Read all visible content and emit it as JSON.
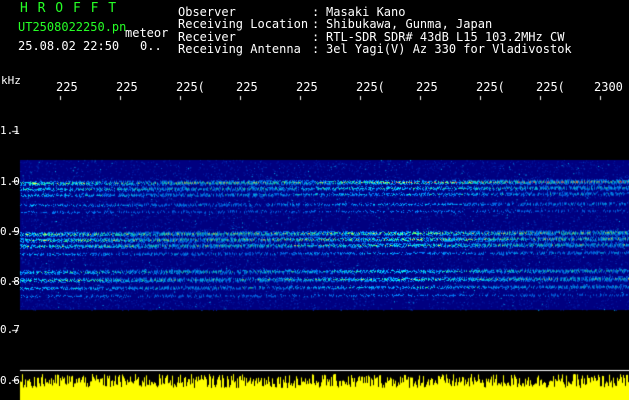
{
  "header": {
    "title": "H R O F F T",
    "filename": "UT2508022250.pn",
    "type_label": "meteor",
    "datetime": "25.08.02 22:50",
    "count": "0.."
  },
  "info": [
    {
      "label": "Observer",
      "sep": ":",
      "value": "Masaki Kano"
    },
    {
      "label": "Receiving Location",
      "sep": ":",
      "value": "Shibukawa, Gunma, Japan"
    },
    {
      "label": "Receiver",
      "sep": ":",
      "value": "RTL-SDR SDR# 43dB L15 103.2MHz CW"
    },
    {
      "label": "Receiving Antenna",
      "sep": ":",
      "value": "3el Yagi(V) Az 330 for Vladivostok"
    }
  ],
  "axis": {
    "unit": "kHz",
    "y_ticks": [
      "1.1",
      "1.0",
      "0.9",
      "0.8",
      "0.7",
      "0.6"
    ],
    "x_ticks": [
      "225",
      "225",
      "225(",
      "225",
      "225",
      "225(",
      "225",
      "225(",
      "225(",
      "2300"
    ]
  },
  "colors": {
    "title_green": "#26ff26",
    "text": "#ffffff",
    "background": "#000000",
    "spectrogram_bg": "#000080",
    "echo_amplitude": "#ffff00"
  }
}
